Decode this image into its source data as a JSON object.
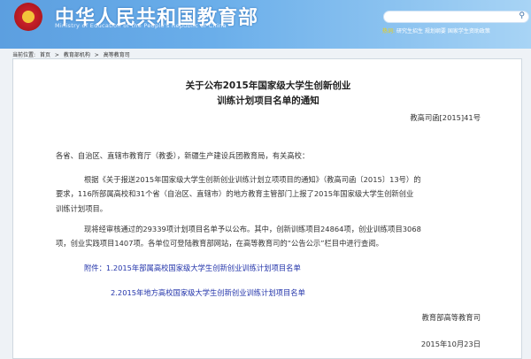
{
  "header": {
    "title_cn": "中华人民共和国教育部",
    "title_en": "Ministry of Education of the People's Republic of China",
    "search_placeholder": "",
    "hot_label": "热词:",
    "hot_words": [
      "研究生招生",
      "规划纲要",
      "国家学生资助政策"
    ]
  },
  "breadcrumb": {
    "label": "当前位置:",
    "items": [
      "首页",
      "教育部机构",
      "高等教育司"
    ],
    "sep": ">"
  },
  "doc": {
    "title_line1": "关于公布2015年国家级大学生创新创业",
    "title_line2": "训练计划项目名单的通知",
    "doc_number": "教高司函[2015]41号",
    "salutation": "各省、自治区、直辖市教育厅（教委），新疆生产建设兵团教育局，有关高校：",
    "para1": [
      "根据《关于报送2015年国家级大学生创新创业训练计划立项项目的通知》（教高司函〔2015〕13号）的",
      "要求，116所部属高校和31个省（自治区、直辖市）的地方教育主管部门上报了2015年国家级大学生创新创业",
      "训练计划项目。"
    ],
    "para2": [
      "现将经审核通过的29339项计划项目名单予以公布。其中，创新训练项目24864项，创业训练项目3068",
      "项，创业实践项目1407项。各单位可登陆教育部网站，在高等教育司的“公告公示”栏目中进行查阅。"
    ],
    "attachment_label": "附件：",
    "attachments": [
      "1.2015年部属高校国家级大学生创新创业训练计划项目名单",
      "2.2015年地方高校国家级大学生创新创业训练计划项目名单"
    ],
    "signature": "教育部高等教育司",
    "date": "2015年10月23日"
  },
  "colors": {
    "header": "#6aaeea",
    "link": "#2233aa"
  }
}
